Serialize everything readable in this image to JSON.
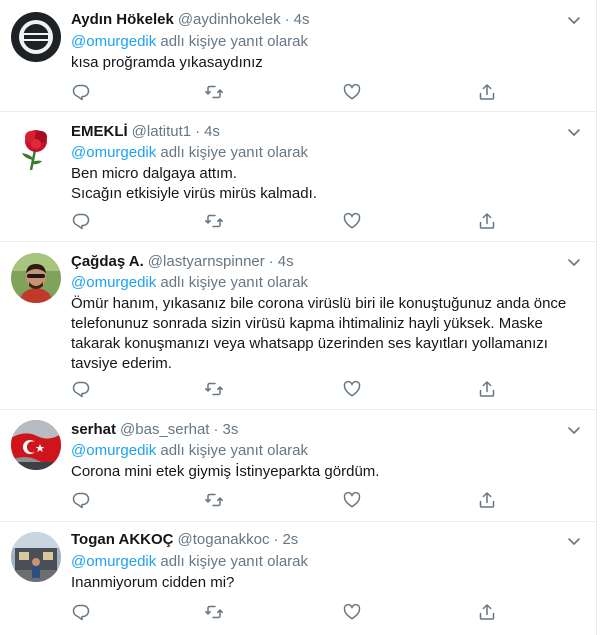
{
  "tweets": [
    {
      "name": "Aydın Hökelek",
      "handle": "@aydinhokelek",
      "time": "4s",
      "reply_prefix": "",
      "reply_mention": "@omurgedik",
      "reply_suffix": " adlı kişiye yanıt olarak",
      "lines": [
        "kısa proğramda yıkasaydınız"
      ]
    },
    {
      "name": "EMEKLİ",
      "handle": "@latitut1",
      "time": "4s",
      "reply_mention": "@omurgedik",
      "reply_suffix": " adlı kişiye yanıt olarak",
      "lines": [
        "Ben micro dalgaya attım.",
        "Sıcağın etkisiyle virüs mirüs kalmadı."
      ]
    },
    {
      "name": "Çağdaş A.",
      "handle": "@lastyarnspinner",
      "time": "4s",
      "reply_mention": "@omurgedik",
      "reply_suffix": " adlı kişiye yanıt olarak",
      "lines": [
        "Ömür hanım, yıkasanız bile corona virüslü biri ile konuştuğunuz anda önce telefonunuz sonrada sizin virüsü kapma ihtimaliniz hayli yüksek. Maske takarak konuşmanızı veya whatsapp üzerinden ses kayıtları yollamanızı tavsiye ederim."
      ]
    },
    {
      "name": "serhat",
      "handle": "@bas_serhat",
      "time": "3s",
      "reply_mention": "@omurgedik",
      "reply_suffix": " adlı kişiye yanıt olarak",
      "lines": [
        "Corona mini etek giymiş İstinyeparkta gördüm."
      ]
    },
    {
      "name": "Togan AKKOÇ",
      "handle": "@toganakkoc",
      "time": "2s",
      "reply_mention": "@omurgedik",
      "reply_suffix": " adlı kişiye yanıt olarak",
      "lines": [
        "Inanmiyorum cidden mi?"
      ]
    }
  ],
  "separator": "·",
  "icons": {
    "reply": "reply-icon",
    "retweet": "retweet-icon",
    "like": "like-icon",
    "share": "share-icon",
    "more": "chevron-down-icon"
  },
  "colors": {
    "link": "#1da1f2",
    "secondary": "#657786",
    "text": "#14171a",
    "border": "#e6ecf0"
  }
}
